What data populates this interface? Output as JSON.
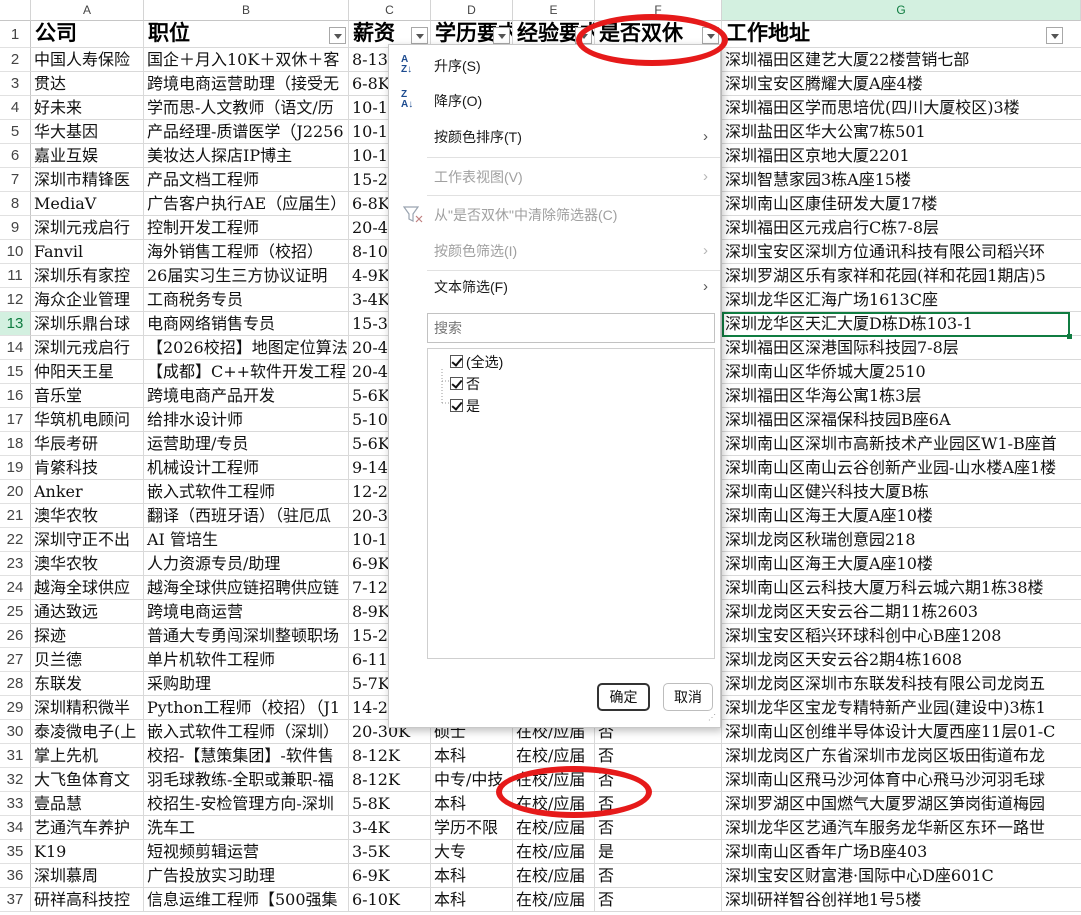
{
  "columns": [
    {
      "letter": "A",
      "header": "公司"
    },
    {
      "letter": "B",
      "header": "职位"
    },
    {
      "letter": "C",
      "header": "薪资"
    },
    {
      "letter": "D",
      "header": "学历要求"
    },
    {
      "letter": "E",
      "header": "经验要求"
    },
    {
      "letter": "F",
      "header": "是否双休"
    },
    {
      "letter": "G",
      "header": "工作地址"
    }
  ],
  "selected_row": 13,
  "rows": [
    {
      "n": 2,
      "c": [
        "中国人寿保险",
        "国企＋月入10K＋双休＋客",
        "8-13",
        "",
        "",
        "",
        "深圳福田区建艺大厦22楼营销七部"
      ]
    },
    {
      "n": 3,
      "c": [
        "贯达",
        "跨境电商运营助理（接受无",
        "6-8K",
        "",
        "",
        "",
        "深圳宝安区腾耀大厦A座4楼"
      ]
    },
    {
      "n": 4,
      "c": [
        "好未来",
        "学而思-人文教师（语文/历",
        "10-1",
        "",
        "",
        "",
        "深圳福田区学而思培优(四川大厦校区)3楼"
      ]
    },
    {
      "n": 5,
      "c": [
        "华大基因",
        "产品经理-质谱医学（J2256",
        "10-1",
        "",
        "",
        "",
        "深圳盐田区华大公寓7栋501"
      ]
    },
    {
      "n": 6,
      "c": [
        "嘉业互娱",
        "美妆达人探店IP博主",
        "10-1",
        "",
        "",
        "",
        "深圳福田区京地大厦2201"
      ]
    },
    {
      "n": 7,
      "c": [
        "深圳市精锋医",
        "产品文档工程师",
        "15-2",
        "",
        "",
        "",
        "深圳智慧家园3栋A座15楼"
      ]
    },
    {
      "n": 8,
      "c": [
        "MediaV",
        "广告客户执行AE（应届生）",
        "6-8K",
        "",
        "",
        "",
        "深圳南山区康佳研发大厦17楼"
      ]
    },
    {
      "n": 9,
      "c": [
        "深圳元戎启行",
        "控制开发工程师",
        "20-4",
        "",
        "",
        "",
        "深圳福田区元戎启行C栋7-8层"
      ]
    },
    {
      "n": 10,
      "c": [
        "Fanvil",
        "海外销售工程师（校招）",
        "8-10",
        "",
        "",
        "",
        "深圳宝安区深圳方位通讯科技有限公司稻兴环"
      ]
    },
    {
      "n": 11,
      "c": [
        "深圳乐有家控",
        "26届实习生三方协议证明",
        "4-9K",
        "",
        "",
        "",
        "深圳罗湖区乐有家祥和花园(祥和花园1期店)5"
      ]
    },
    {
      "n": 12,
      "c": [
        "海众企业管理",
        "工商税务专员",
        "3-4K",
        "",
        "",
        "",
        "深圳龙华区汇海广场1613C座"
      ]
    },
    {
      "n": 13,
      "c": [
        "深圳乐鼎台球",
        "电商网络销售专员",
        "15-3",
        "",
        "",
        "",
        "深圳龙华区天汇大厦D栋D栋103-1"
      ]
    },
    {
      "n": 14,
      "c": [
        "深圳元戎启行",
        "【2026校招】地图定位算法",
        "20-4",
        "",
        "",
        "",
        "深圳福田区深港国际科技园7-8层"
      ]
    },
    {
      "n": 15,
      "c": [
        "仲阳天王星",
        "【成都】C++软件开发工程",
        "20-4",
        "",
        "",
        "",
        "深圳南山区华侨城大厦2510"
      ]
    },
    {
      "n": 16,
      "c": [
        "音乐堂",
        "跨境电商产品开发",
        "5-6K",
        "",
        "",
        "",
        "深圳福田区华海公寓1栋3层"
      ]
    },
    {
      "n": 17,
      "c": [
        "华筑机电顾问",
        "给排水设计师",
        "5-10",
        "",
        "",
        "",
        "深圳福田区深福保科技园B座6A"
      ]
    },
    {
      "n": 18,
      "c": [
        "华辰考研",
        "运营助理/专员",
        "5-6K",
        "",
        "",
        "",
        "深圳南山区深圳市高新技术产业园区W1-B座首"
      ]
    },
    {
      "n": 19,
      "c": [
        "肯綮科技",
        "机械设计工程师",
        "9-14",
        "",
        "",
        "",
        "深圳南山区南山云谷创新产业园-山水楼A座1楼"
      ]
    },
    {
      "n": 20,
      "c": [
        "Anker",
        "嵌入式软件工程师",
        "12-2",
        "",
        "",
        "",
        "深圳南山区健兴科技大厦B栋"
      ]
    },
    {
      "n": 21,
      "c": [
        "澳华农牧",
        "翻译（西班牙语）（驻厄瓜",
        "20-3",
        "",
        "",
        "",
        "深圳南山区海王大厦A座10楼"
      ]
    },
    {
      "n": 22,
      "c": [
        "深圳守正不出",
        "AI 管培生",
        "10-1",
        "",
        "",
        "",
        "深圳龙岗区秋瑞创意园218"
      ]
    },
    {
      "n": 23,
      "c": [
        "澳华农牧",
        "人力资源专员/助理",
        "6-9K",
        "",
        "",
        "",
        "深圳南山区海王大厦A座10楼"
      ]
    },
    {
      "n": 24,
      "c": [
        "越海全球供应",
        "越海全球供应链招聘供应链",
        "7-12",
        "",
        "",
        "",
        "深圳南山区云科技大厦万科云城六期1栋38楼"
      ]
    },
    {
      "n": 25,
      "c": [
        "通达致远",
        "跨境电商运营",
        "8-9K",
        "",
        "",
        "",
        "深圳龙岗区天安云谷二期11栋2603"
      ]
    },
    {
      "n": 26,
      "c": [
        "探迹",
        "普通大专勇闯深圳整顿职场",
        "15-2",
        "",
        "",
        "",
        "深圳宝安区稻兴环球科创中心B座1208"
      ]
    },
    {
      "n": 27,
      "c": [
        "贝兰德",
        "单片机软件工程师",
        "6-11",
        "",
        "",
        "",
        "深圳龙岗区天安云谷2期4栋1608"
      ]
    },
    {
      "n": 28,
      "c": [
        "东联发",
        "采购助理",
        "5-7K",
        "",
        "",
        "",
        "深圳龙岗区深圳市东联发科技有限公司龙岗五"
      ]
    },
    {
      "n": 29,
      "c": [
        "深圳精积微半",
        "Python工程师（校招）（J1",
        "14-2",
        "",
        "",
        "",
        "深圳龙华区宝龙专精特新产业园(建设中)3栋1"
      ]
    },
    {
      "n": 30,
      "c": [
        "泰凌微电子(上",
        "嵌入式软件工程师（深圳）",
        "20-30K",
        "硕士",
        "在校/应届",
        "否",
        "深圳南山区创维半导体设计大厦西座11层01-C"
      ]
    },
    {
      "n": 31,
      "c": [
        "掌上先机",
        "校招-【慧策集团】-软件售",
        "8-12K",
        "本科",
        "在校/应届",
        "否",
        "深圳龙岗区广东省深圳市龙岗区坂田街道布龙"
      ]
    },
    {
      "n": 32,
      "c": [
        "大飞鱼体育文",
        "羽毛球教练-全职或兼职-福",
        "8-12K",
        "中专/中技",
        "在校/应届",
        "否",
        "深圳南山区飛马沙河体育中心飛马沙河羽毛球"
      ]
    },
    {
      "n": 33,
      "c": [
        "壹品慧",
        "校招生-安检管理方向-深圳",
        "5-8K",
        "本科",
        "在校/应届",
        "否",
        "深圳罗湖区中国燃气大厦罗湖区笋岗街道梅园"
      ]
    },
    {
      "n": 34,
      "c": [
        "艺通汽车养护",
        "洗车工",
        "3-4K",
        "学历不限",
        "在校/应届",
        "否",
        "深圳龙华区艺通汽车服务龙华新区东环一路世"
      ]
    },
    {
      "n": 35,
      "c": [
        "K19",
        "短视频剪辑运营",
        "3-5K",
        "大专",
        "在校/应届",
        "是",
        "深圳南山区香年广场B座403"
      ]
    },
    {
      "n": 36,
      "c": [
        "深圳慕周",
        "广告投放实习助理",
        "6-9K",
        "本科",
        "在校/应届",
        "否",
        "深圳宝安区财富港·国际中心D座601C"
      ]
    },
    {
      "n": 37,
      "c": [
        "研祥高科技控",
        "信息运维工程师【500强集",
        "6-10K",
        "本科",
        "在校/应届",
        "否",
        "深圳研祥智谷创祥地1号5楼"
      ]
    }
  ],
  "filter_menu": {
    "sort_asc": "升序(S)",
    "sort_desc": "降序(O)",
    "sort_by_color": "按颜色排序(T)",
    "sheet_view": "工作表视图(V)",
    "clear_filter": "从\"是否双休\"中清除筛选器(C)",
    "filter_by_color": "按颜色筛选(I)",
    "text_filter": "文本筛选(F)",
    "search_placeholder": "搜索",
    "options": [
      {
        "label": "(全选)",
        "checked": true
      },
      {
        "label": "否",
        "checked": true
      },
      {
        "label": "是",
        "checked": true
      }
    ],
    "ok": "确定",
    "cancel": "取消"
  },
  "colors": {
    "annotation": "#e61a1a",
    "excel_green": "#107c41"
  }
}
